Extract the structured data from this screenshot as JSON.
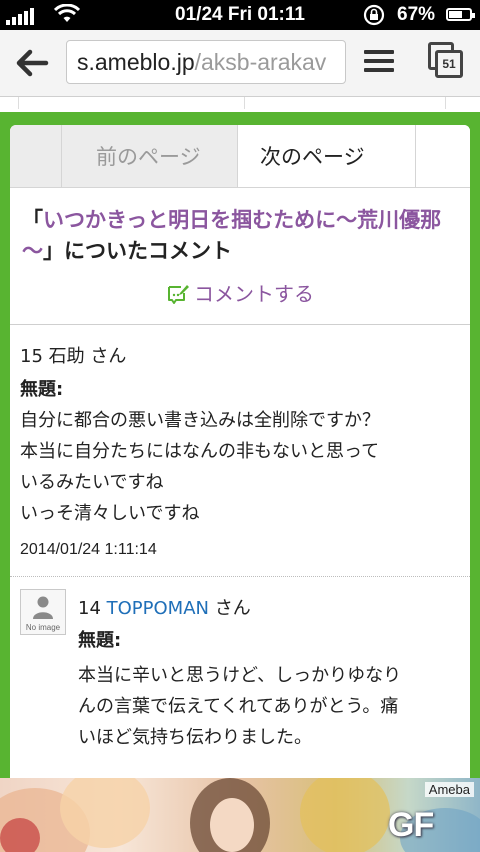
{
  "status_bar": {
    "datetime": "01/24 Fri 01:11",
    "battery": "67%",
    "battery_level": 0.67
  },
  "browser": {
    "url_host": "s.ameblo.jp",
    "url_path": "/aksb-arakav",
    "tabs_count": "51",
    "icons": {
      "back": "back-arrow-icon",
      "menu": "menu-icon",
      "tabs": "tabs-icon"
    }
  },
  "pager": {
    "prev_label": "前のページ",
    "next_label": "次のページ"
  },
  "post": {
    "title_open": "「",
    "title_link": "いつかきっと明日を掴むために～荒川優那～",
    "title_tail": "」についたコメント",
    "comment_button": "コメントする"
  },
  "comments": [
    {
      "number": "15",
      "author": "石助",
      "honorific": "さん",
      "subject": "無題:",
      "lines": [
        "自分に都合の悪い書き込みは全削除ですか？",
        "本当に自分たちにはなんの非もないと思って",
        "いるみたいですね",
        "いっそ清々しいですね"
      ],
      "date": "2014/01/24 1:11:14"
    },
    {
      "number": "14",
      "author": "TOPPOMAN",
      "honorific": "さん",
      "subject": "無題:",
      "avatar_caption": "No image",
      "lines": [
        "本当に辛いと思うけど、しっかりゆなり",
        "んの言葉で伝えてくれてありがとう。痛",
        "いほど気持ち伝わりました。"
      ]
    }
  ],
  "banner": {
    "brand": "Ameba",
    "logo": "GF"
  },
  "colors": {
    "frame_green": "#58b431",
    "pager_arrow_green": "#43a32a",
    "title_purple": "#8b569f",
    "link_blue": "#1f6fb8"
  }
}
